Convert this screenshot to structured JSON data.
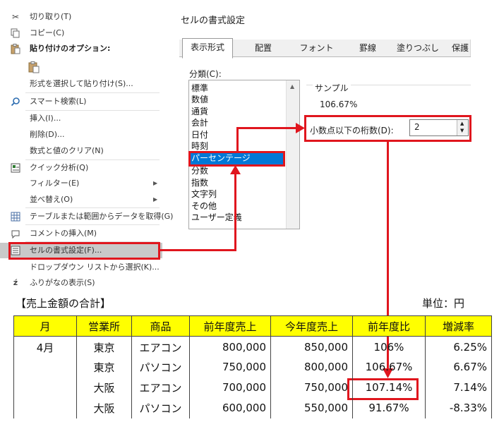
{
  "context_menu": {
    "items": [
      {
        "label": "切り取り(T)",
        "icon": "scissors-icon"
      },
      {
        "label": "コピー(C)",
        "icon": "copy-icon"
      },
      {
        "label": "貼り付けのオプション:",
        "icon": "paste-icon"
      },
      {
        "label": "",
        "icon": "paste-option-icon"
      },
      {
        "label": "形式を選択して貼り付け(S)...",
        "icon": ""
      },
      {
        "label": "スマート検索(L)",
        "icon": "search-icon"
      },
      {
        "label": "挿入(I)...",
        "icon": ""
      },
      {
        "label": "削除(D)...",
        "icon": ""
      },
      {
        "label": "数式と値のクリア(N)",
        "icon": ""
      },
      {
        "label": "クイック分析(Q)",
        "icon": "quick-analysis-icon"
      },
      {
        "label": "フィルター(E)",
        "icon": ""
      },
      {
        "label": "並べ替え(O)",
        "icon": ""
      },
      {
        "label": "テーブルまたは範囲からデータを取得(G)...",
        "icon": "table-icon"
      },
      {
        "label": "コメントの挿入(M)",
        "icon": "comment-icon"
      },
      {
        "label": "セルの書式設定(F)...",
        "icon": "format-cells-icon"
      },
      {
        "label": "ドロップダウン リストから選択(K)...",
        "icon": ""
      },
      {
        "label": "ふりがなの表示(S)",
        "icon": "furigana-icon"
      }
    ]
  },
  "dialog": {
    "title": "セルの書式設定",
    "tabs": [
      "表示形式",
      "配置",
      "フォント",
      "罫線",
      "塗りつぶし",
      "保護"
    ],
    "active_tab": "表示形式",
    "category_label": "分類(C):",
    "categories": [
      "標準",
      "数値",
      "通貨",
      "会計",
      "日付",
      "時刻",
      "パーセンテージ",
      "分数",
      "指数",
      "文字列",
      "その他",
      "ユーザー定義"
    ],
    "selected_category": "パーセンテージ",
    "sample_label": "サンプル",
    "sample_value": "106.67%",
    "decimal_label": "小数点以下の桁数(D):",
    "decimal_value": "2"
  },
  "table": {
    "title": "【売上金額の合計】",
    "unit": "単位：円",
    "headers": [
      "月",
      "営業所",
      "商品",
      "前年度売上",
      "今年度売上",
      "前年度比",
      "増減率"
    ],
    "rows": [
      [
        "4月",
        "東京",
        "エアコン",
        "800,000",
        "850,000",
        "106%",
        "6.25%"
      ],
      [
        "",
        "東京",
        "パソコン",
        "750,000",
        "800,000",
        "106.67%",
        "6.67%"
      ],
      [
        "",
        "大阪",
        "エアコン",
        "700,000",
        "750,000",
        "107.14%",
        "7.14%"
      ],
      [
        "",
        "大阪",
        "パソコン",
        "600,000",
        "550,000",
        "91.67%",
        "-8.33%"
      ]
    ]
  },
  "colors": {
    "highlight_red": "#e0161e",
    "header_yellow": "#ffff00",
    "selection_blue": "#0078d7"
  }
}
